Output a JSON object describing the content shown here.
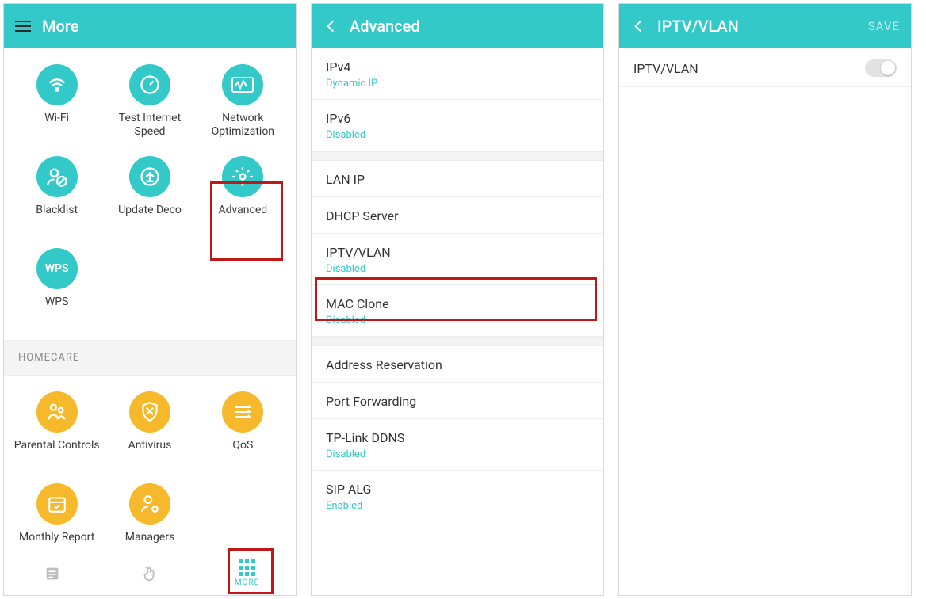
{
  "more": {
    "title": "More",
    "tiles": [
      {
        "label": "Wi-Fi",
        "icon": "wifi-icon"
      },
      {
        "label": "Test Internet Speed",
        "icon": "gauge-icon"
      },
      {
        "label": "Network Optimization",
        "icon": "waveform-icon"
      },
      {
        "label": "Blacklist",
        "icon": "user-block-icon"
      },
      {
        "label": "Update Deco",
        "icon": "update-icon"
      },
      {
        "label": "Advanced",
        "icon": "gear-icon"
      },
      {
        "label": "WPS",
        "icon": "wps-icon"
      }
    ],
    "section": "HOMECARE",
    "homecare": [
      {
        "label": "Parental Controls",
        "icon": "parental-icon"
      },
      {
        "label": "Antivirus",
        "icon": "shield-icon"
      },
      {
        "label": "QoS",
        "icon": "qos-icon"
      },
      {
        "label": "Monthly Report",
        "icon": "calendar-icon"
      },
      {
        "label": "Managers",
        "icon": "managers-icon"
      }
    ],
    "tabbar": {
      "more": "MORE"
    }
  },
  "advanced": {
    "title": "Advanced",
    "rows": [
      {
        "label": "IPv4",
        "sub": "Dynamic IP"
      },
      {
        "label": "IPv6",
        "sub": "Disabled"
      },
      {
        "label": "LAN IP"
      },
      {
        "label": "DHCP Server"
      },
      {
        "label": "IPTV/VLAN",
        "sub": "Disabled"
      },
      {
        "label": "MAC Clone",
        "sub": "Disabled"
      },
      {
        "label": "Address Reservation"
      },
      {
        "label": "Port Forwarding"
      },
      {
        "label": "TP-Link DDNS",
        "sub": "Disabled"
      },
      {
        "label": "SIP ALG",
        "sub": "Enabled"
      }
    ]
  },
  "iptv": {
    "title": "IPTV/VLAN",
    "save": "SAVE",
    "row_label": "IPTV/VLAN"
  }
}
